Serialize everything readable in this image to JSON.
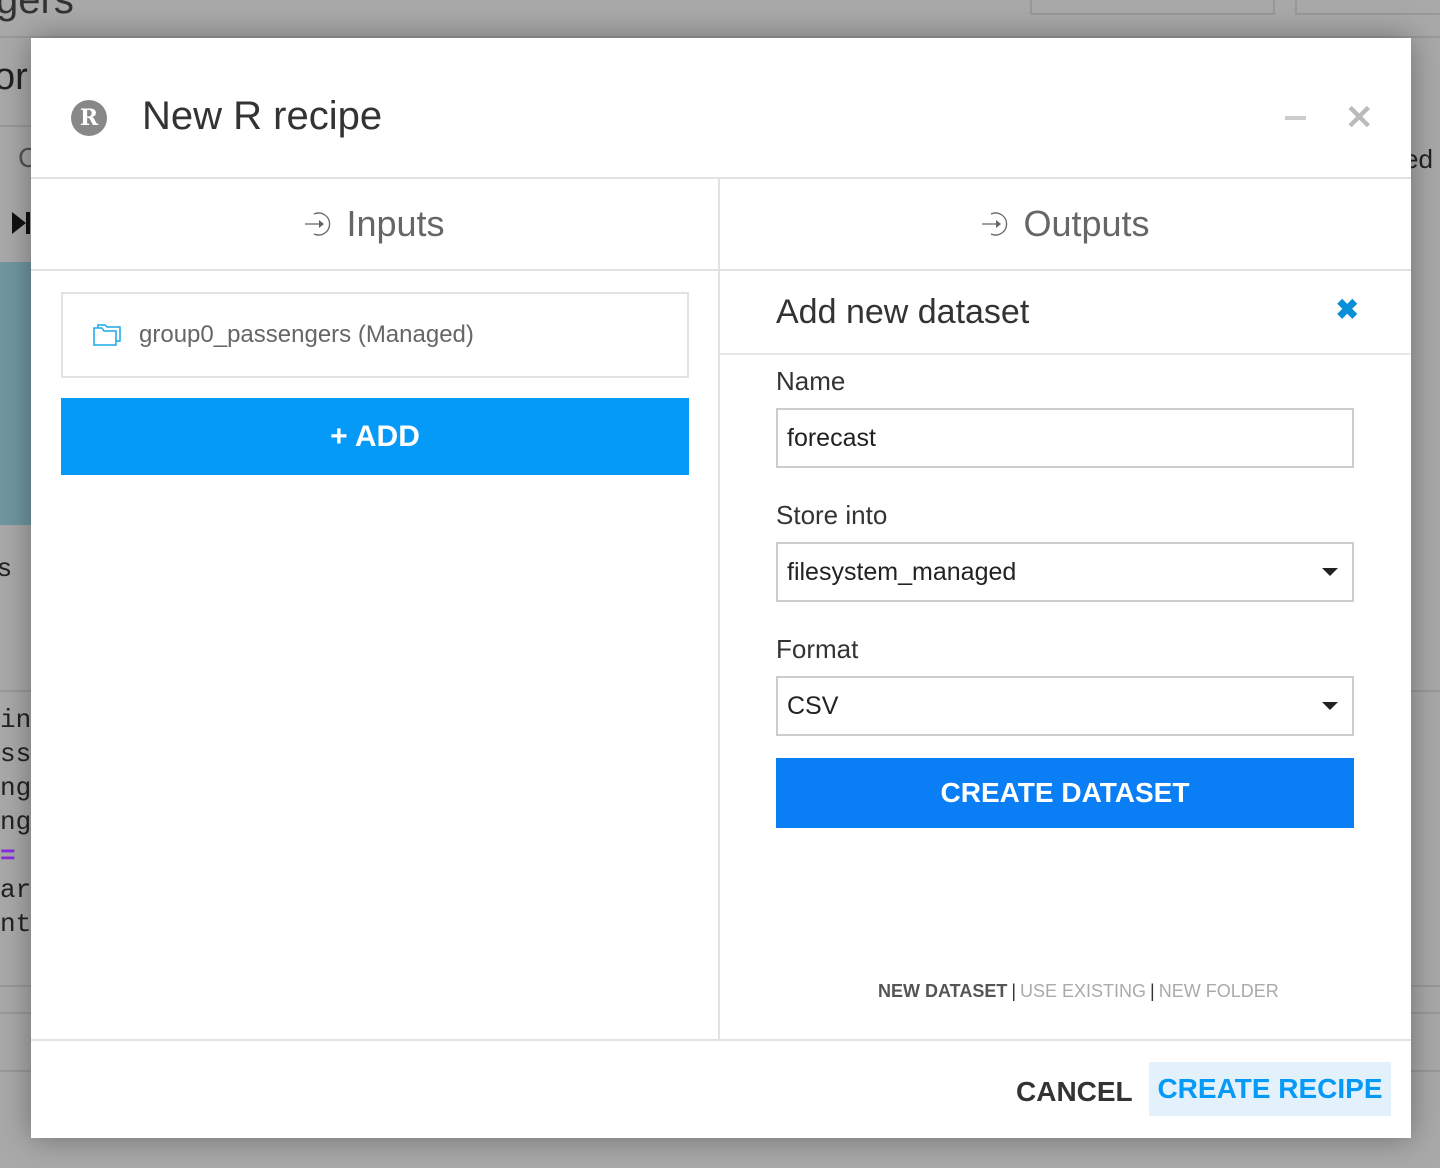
{
  "background": {
    "top_fragment": "gers",
    "fragment_1": "or",
    "fragment_2": "C",
    "fragment_3": "s",
    "fragment_right": "ed",
    "code_lines": [
      "in",
      "ss",
      "ng",
      "ng",
      "= ",
      "ar",
      "nt"
    ],
    "teal_color": "#6f97a0"
  },
  "modal": {
    "title": "New R recipe",
    "icon": "r-logo-icon",
    "inputs_header": "Inputs",
    "outputs_header": "Outputs",
    "input_items": [
      {
        "label": "group0_passengers (Managed)",
        "icon": "folder-icon"
      }
    ],
    "add_label": "+ ADD",
    "new_dataset": {
      "title": "Add new dataset",
      "name_label": "Name",
      "name_value": "forecast",
      "store_label": "Store into",
      "store_value": "filesystem_managed",
      "format_label": "Format",
      "format_value": "CSV",
      "create_label": "CREATE DATASET"
    },
    "modes": [
      "NEW DATASET",
      "USE EXISTING",
      "NEW FOLDER"
    ],
    "cancel_label": "CANCEL",
    "create_recipe_label": "CREATE RECIPE",
    "accent_color": "#0599f8"
  }
}
